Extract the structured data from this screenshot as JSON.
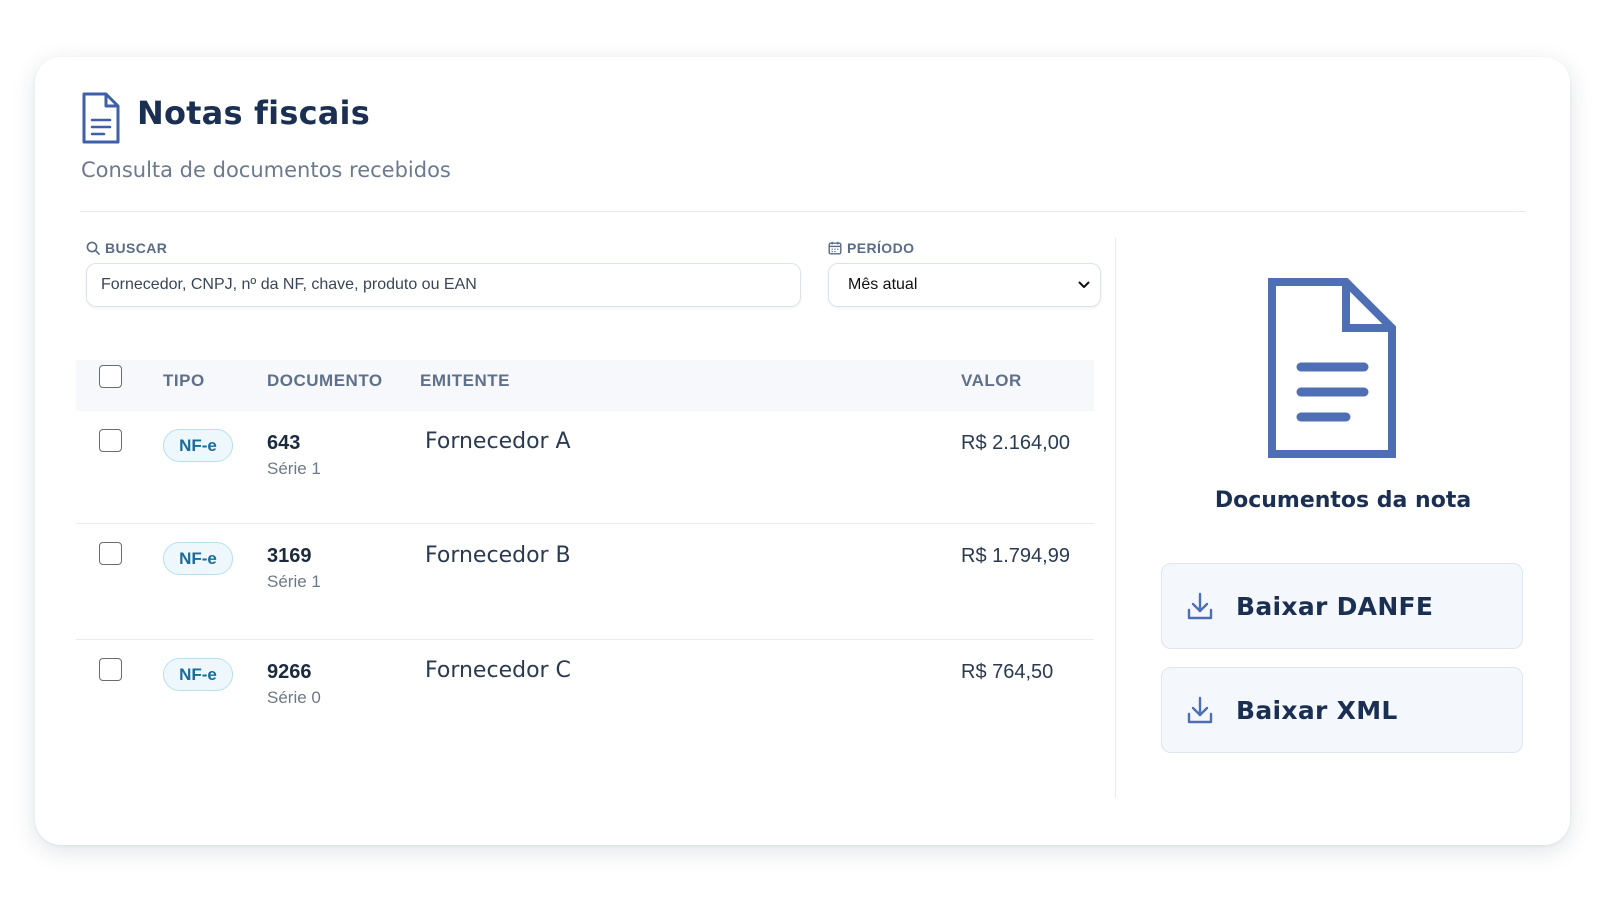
{
  "header": {
    "title": "Notas fiscais",
    "subtitle": "Consulta de documentos recebidos",
    "icon": "document-icon"
  },
  "filters": {
    "search": {
      "label": "BUSCAR",
      "icon": "search-icon",
      "placeholder": "Fornecedor, CNPJ, nº da NF, chave, produto ou EAN",
      "value": ""
    },
    "period": {
      "label": "PERÍODO",
      "icon": "calendar-icon",
      "selected": "Mês atual"
    }
  },
  "table": {
    "columns": {
      "tipo": "TIPO",
      "documento": "DOCUMENTO",
      "emitente": "EMITENTE",
      "valor": "VALOR"
    },
    "rows": [
      {
        "tipo": "NF-e",
        "numero": "643",
        "serie": "Série 1",
        "emitente": "Fornecedor A",
        "valor": "R$ 2.164,00"
      },
      {
        "tipo": "NF-e",
        "numero": "3169",
        "serie": "Série 1",
        "emitente": "Fornecedor B",
        "valor": "R$ 1.794,99"
      },
      {
        "tipo": "NF-e",
        "numero": "9266",
        "serie": "Série 0",
        "emitente": "Fornecedor C",
        "valor": "R$ 764,50"
      }
    ]
  },
  "panel": {
    "title": "Documentos da nota",
    "icon": "document-icon",
    "buttons": {
      "danfe": "Baixar DANFE",
      "xml": "Baixar XML"
    }
  },
  "colors": {
    "accent": "#4f6fb5",
    "title": "#1a2f52",
    "badge_text": "#1a6b9a",
    "badge_bg": "#eef8fc"
  }
}
